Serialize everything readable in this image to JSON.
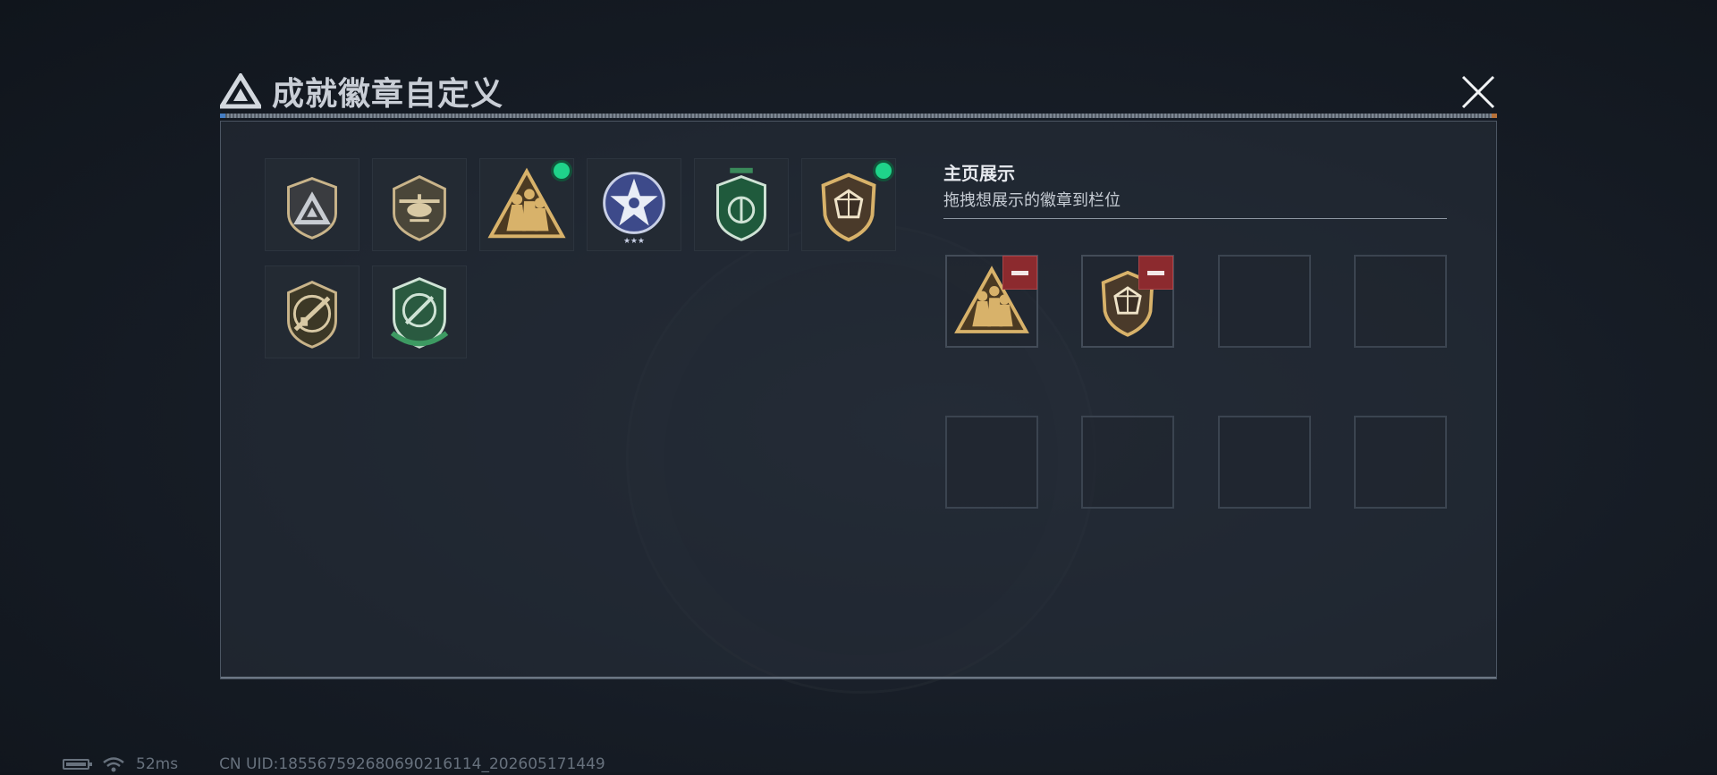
{
  "header": {
    "title": "成就徽章自定义",
    "logo_icon": "triangle-logo-icon",
    "close_icon": "close-icon"
  },
  "badges": [
    {
      "name": "badge-triangle-logo",
      "icon": "triangle-logo-badge-icon",
      "new": false
    },
    {
      "name": "badge-helicopter",
      "icon": "helicopter-badge-icon",
      "new": false
    },
    {
      "name": "badge-soldiers-triangle",
      "icon": "soldiers-triangle-badge-icon",
      "new": true
    },
    {
      "name": "badge-star-blue",
      "icon": "star-badge-icon",
      "new": false
    },
    {
      "name": "badge-green-shield",
      "icon": "green-shield-badge-icon",
      "new": false
    },
    {
      "name": "badge-crystal-shield",
      "icon": "crystal-shield-badge-icon",
      "new": true
    },
    {
      "name": "badge-rifle-shield",
      "icon": "rifle-shield-badge-icon",
      "new": false
    },
    {
      "name": "badge-green-target",
      "icon": "green-target-badge-icon",
      "new": false
    }
  ],
  "display": {
    "title": "主页展示",
    "subtitle": "拖拽想展示的徽章到栏位",
    "slots": [
      {
        "badge": "soldiers-triangle-badge-icon"
      },
      {
        "badge": "crystal-shield-badge-icon"
      },
      {
        "badge": null
      },
      {
        "badge": null
      },
      {
        "badge": null
      },
      {
        "badge": null
      },
      {
        "badge": null
      },
      {
        "badge": null
      }
    ]
  },
  "status": {
    "ping": "52ms",
    "uid": "CN UID:185567592680690216114_202605171449"
  },
  "colors": {
    "new_dot": "#1fd38a",
    "remove": "#8c2a2e",
    "gold": "#d8b26a"
  }
}
